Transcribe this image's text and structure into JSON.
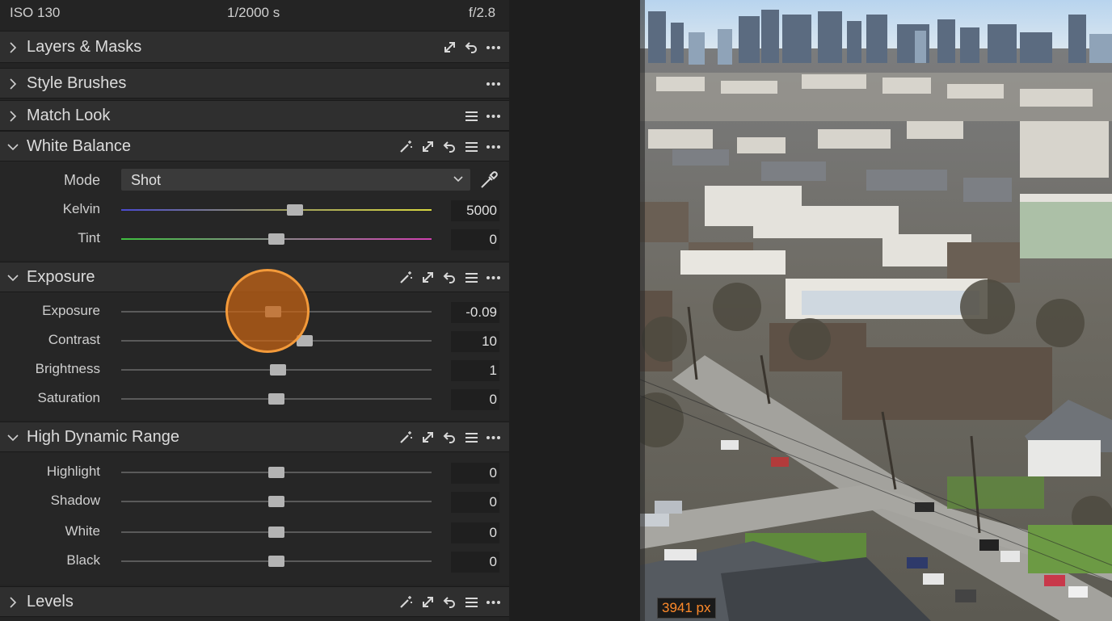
{
  "exif": {
    "iso": "ISO 130",
    "shutter": "1/2000 s",
    "aperture": "f/2.8"
  },
  "tools": {
    "layers_masks": {
      "title": "Layers & Masks",
      "expanded": false
    },
    "style_brushes": {
      "title": "Style Brushes",
      "expanded": false
    },
    "match_look": {
      "title": "Match Look",
      "expanded": false
    },
    "white_balance": {
      "title": "White Balance",
      "expanded": true,
      "mode_label": "Mode",
      "mode_value": "Shot",
      "sliders": [
        {
          "label": "Kelvin",
          "value": "5000",
          "pos": 0.56,
          "gradient": "blue-yellow"
        },
        {
          "label": "Tint",
          "value": "0",
          "pos": 0.5,
          "gradient": "green-magenta"
        }
      ]
    },
    "exposure": {
      "title": "Exposure",
      "expanded": true,
      "sliders": [
        {
          "label": "Exposure",
          "value": "-0.09",
          "pos": 0.49
        },
        {
          "label": "Contrast",
          "value": "10",
          "pos": 0.59
        },
        {
          "label": "Brightness",
          "value": "1",
          "pos": 0.505
        },
        {
          "label": "Saturation",
          "value": "0",
          "pos": 0.5
        }
      ]
    },
    "hdr": {
      "title": "High Dynamic Range",
      "expanded": true,
      "sliders": [
        {
          "label": "Highlight",
          "value": "0",
          "pos": 0.5
        },
        {
          "label": "Shadow",
          "value": "0",
          "pos": 0.5
        },
        {
          "label": "White",
          "value": "0",
          "pos": 0.5
        },
        {
          "label": "Black",
          "value": "0",
          "pos": 0.5
        }
      ]
    },
    "levels": {
      "title": "Levels",
      "expanded": false
    }
  },
  "viewer": {
    "width_readout": "3941 px"
  },
  "colors": {
    "accent_cursor": "#f39a3a",
    "panel_bg": "#242424",
    "header_bg": "#2f2f2f"
  },
  "icons": [
    "chevron-right-icon",
    "chevron-down-icon",
    "magic-wand-icon",
    "expand-icon",
    "reset-icon",
    "menu-icon",
    "more-icon",
    "eyedropper-icon"
  ]
}
